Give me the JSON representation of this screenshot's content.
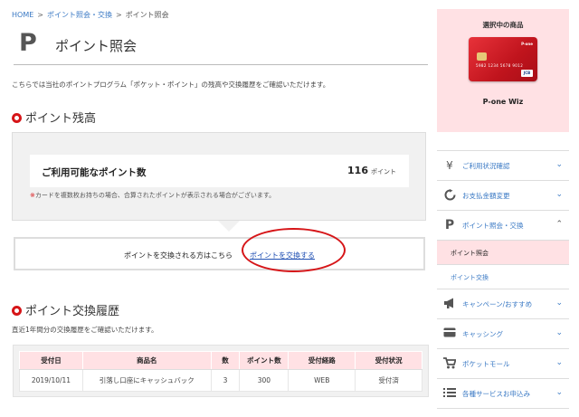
{
  "breadcrumb": {
    "home": "HOME",
    "sep": ">",
    "level2": "ポイント照会・交換",
    "current": "ポイント照会"
  },
  "page": {
    "title_icon": "P",
    "title": "ポイント照会",
    "intro": "こちらでは当社のポイントプログラム「ポケット・ポイント」の残高や交換履歴をご確認いただけます。"
  },
  "balance": {
    "heading": "ポイント残高",
    "label": "ご利用可能なポイント数",
    "value": "116",
    "unit": "ポイント",
    "note_mark": "※",
    "note": "カードを複数枚お持ちの場合、合算されたポイントが表示される場合がございます。"
  },
  "exchange": {
    "prompt": "ポイントを交換される方はこちら",
    "link": "ポイントを交換する"
  },
  "history": {
    "heading": "ポイント交換履歴",
    "note": "直近1年間分の交換履歴をご確認いただけます。",
    "columns": [
      "受付日",
      "商品名",
      "数",
      "ポイント数",
      "受付経路",
      "受付状況"
    ],
    "rows": [
      [
        "2019/10/11",
        "引落し口座にキャッシュバック",
        "3",
        "300",
        "WEB",
        "受付済"
      ]
    ]
  },
  "card": {
    "caption": "選択中の商品",
    "name": "P-one Wiz",
    "brand": "P-one",
    "number": "5982 1234 5678 9012",
    "network": "JCB"
  },
  "side_menu": {
    "items": [
      {
        "icon": "yen-icon",
        "label": "ご利用状況確認",
        "chev": "⌄"
      },
      {
        "icon": "refresh-icon",
        "label": "お支払金額変更",
        "chev": "⌄"
      },
      {
        "icon": "p-icon",
        "label": "ポイント照会・交換",
        "chev": "⌃"
      },
      {
        "icon": "megaphone-icon",
        "label": "キャンペーン/おすすめ",
        "chev": "⌄"
      },
      {
        "icon": "card-icon",
        "label": "キャッシング",
        "chev": "⌄"
      },
      {
        "icon": "cart-icon",
        "label": "ポケットモール",
        "chev": "⌄"
      },
      {
        "icon": "list-icon",
        "label": "各種サービスお申込み",
        "chev": "⌄"
      }
    ],
    "sub_items": [
      {
        "label": "ポイント照会"
      },
      {
        "label": "ポイント交換"
      }
    ]
  },
  "colors": {
    "accent": "#d61518",
    "link": "#3a79c4",
    "pink_bg": "#ffe1e4"
  }
}
